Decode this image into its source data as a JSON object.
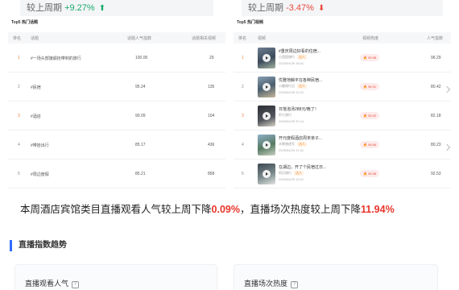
{
  "compare": {
    "left": {
      "label": "较上周期",
      "value": "+9.27%",
      "color": "#1aaa6a"
    },
    "right": {
      "label": "较上周期",
      "value": "-3.47%",
      "color": "#e84a3b"
    }
  },
  "topics_panel": {
    "title": "Top5 热门话题",
    "headers": [
      "排名",
      "话题",
      "话题人气指数",
      "话题相关视频"
    ],
    "rows": [
      {
        "rank": "1",
        "name": "#一场头部旗舰抢带到的旅行",
        "index": "100.00",
        "videos": "29"
      },
      {
        "rank": "2",
        "name": "#民宿",
        "index": "95.24",
        "videos": "135"
      },
      {
        "rank": "3",
        "name": "#酒店",
        "index": "90.09",
        "videos": "104"
      },
      {
        "rank": "4",
        "name": "#带娃出行",
        "index": "85.17",
        "videos": "436"
      },
      {
        "rank": "5",
        "name": "#周边度假",
        "index": "85.21",
        "videos": "858"
      }
    ]
  },
  "videos_panel": {
    "title": "Top5 热门视频",
    "headers": [
      "排名",
      "视频",
      "视频热度",
      "人气指数"
    ],
    "rows": [
      {
        "rank": "1",
        "title": "#重庆周边好看的住宿...",
        "author": "小团团旅行",
        "tag": "达人",
        "date": "2025/04/28 18:41",
        "heat": "99.98",
        "pop": "96.29"
      },
      {
        "rank": "2",
        "title": "优雅地躺平在各种民宿...",
        "author": "小趣旅行记",
        "tag": "达人",
        "date": "2025/04/28 11:02",
        "heat": "96.91",
        "pop": "80.42"
      },
      {
        "rank": "3",
        "title": "日落泡汤288元/晚了！",
        "author": "阿七旅行",
        "tag": "",
        "date": "2025/04/29 20:14",
        "heat": "95.92",
        "pop": "82.18"
      },
      {
        "rank": "4",
        "title": "开元度假酒店周末亲子...",
        "author": "水果旅途号",
        "tag": "达人",
        "date": "2025/04/29 21:01",
        "heat": "96.66",
        "pop": "80.23"
      },
      {
        "rank": "5",
        "title": "在湖边，开了个民宿过日...",
        "author": "阿贝旅行",
        "tag": "达人",
        "date": "2025/04/29 12:21",
        "heat": "95.38",
        "pop": "92.53"
      }
    ]
  },
  "summary": {
    "part1": "本周酒店宾馆类目直播观看人气较上周下降",
    "value1": "0.09%",
    "part2": "，直播场次热度较上周下降",
    "value2": "11.94%"
  },
  "section": {
    "title": "直播指数趋势"
  },
  "metrics": {
    "left": {
      "label": "直播观看人气"
    },
    "right": {
      "label": "直播场次热度"
    }
  }
}
